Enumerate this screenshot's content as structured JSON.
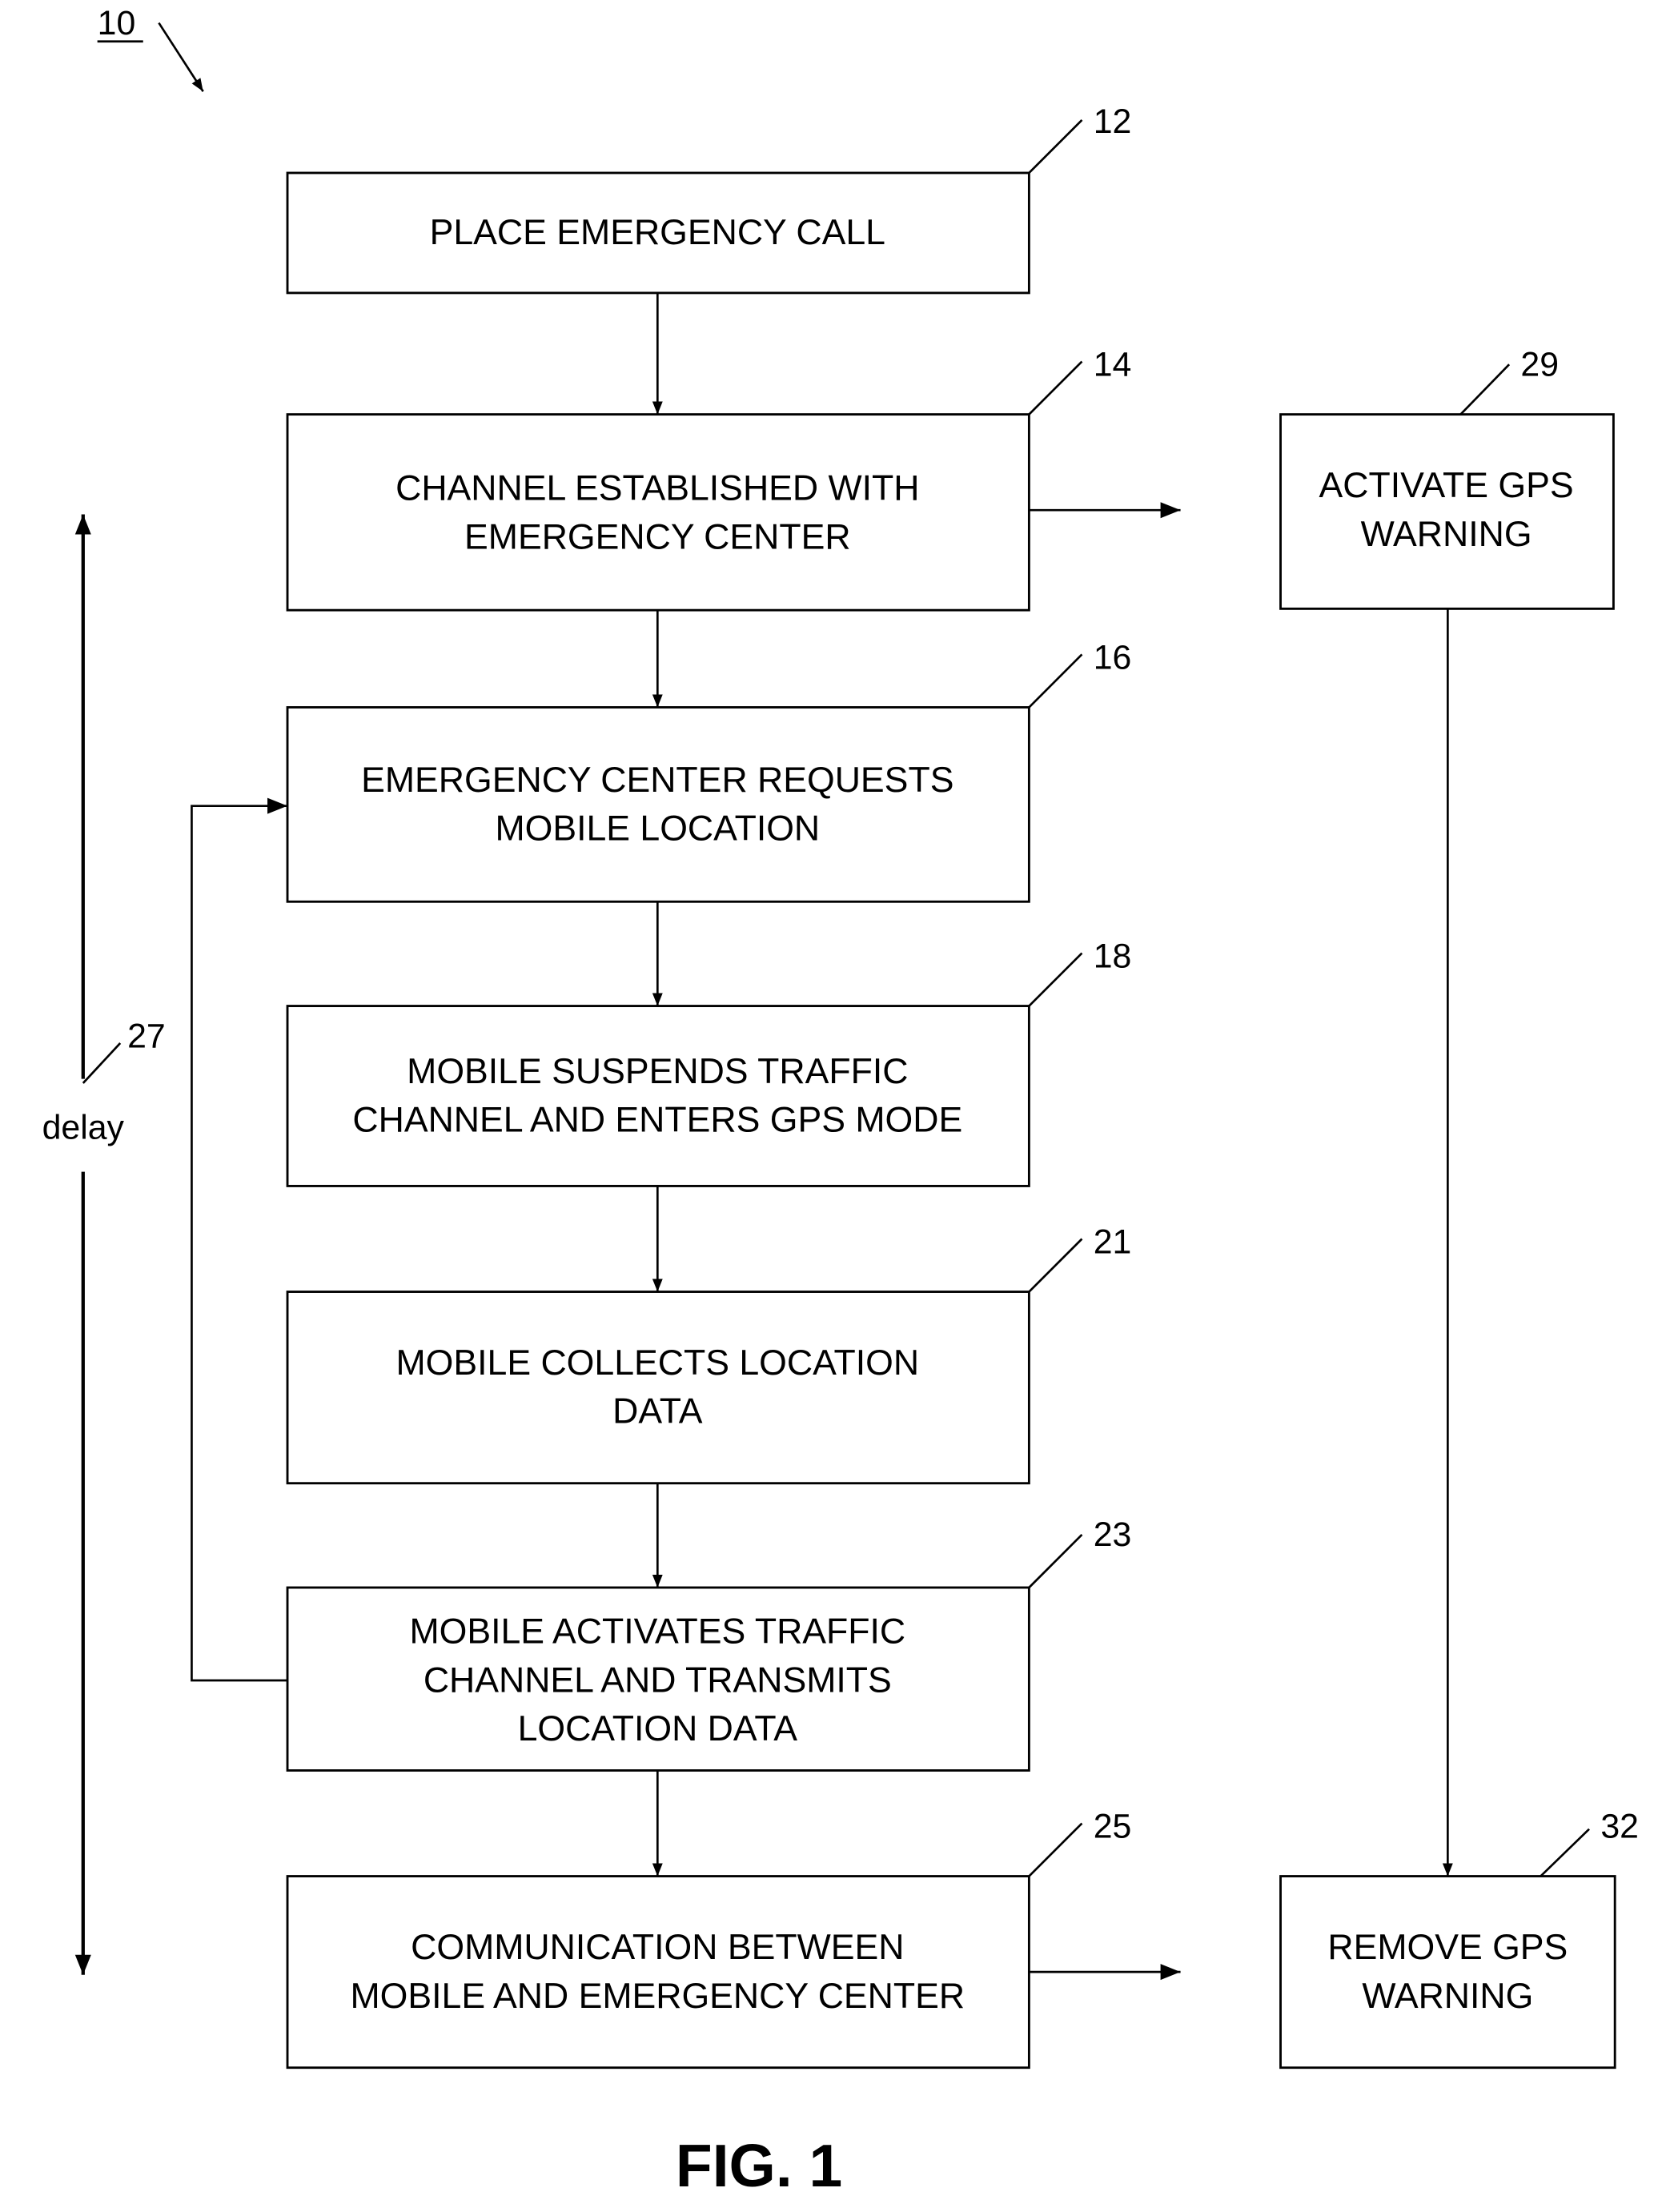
{
  "figure_ref": "10",
  "figure_caption": "FIG. 1",
  "delay_label": "delay",
  "delay_ref": "27",
  "steps": [
    {
      "ref": "12",
      "lines": [
        "PLACE EMERGENCY CALL"
      ]
    },
    {
      "ref": "14",
      "lines": [
        "CHANNEL ESTABLISHED WITH",
        "EMERGENCY CENTER"
      ]
    },
    {
      "ref": "16",
      "lines": [
        "EMERGENCY CENTER REQUESTS",
        "MOBILE LOCATION"
      ]
    },
    {
      "ref": "18",
      "lines": [
        "MOBILE SUSPENDS TRAFFIC",
        "CHANNEL AND ENTERS GPS MODE"
      ]
    },
    {
      "ref": "21",
      "lines": [
        "MOBILE COLLECTS  LOCATION",
        "DATA"
      ]
    },
    {
      "ref": "23",
      "lines": [
        "MOBILE ACTIVATES  TRAFFIC",
        "CHANNEL AND TRANSMITS",
        "LOCATION DATA"
      ]
    },
    {
      "ref": "25",
      "lines": [
        "COMMUNICATION BETWEEN",
        "MOBILE AND EMERGENCY CENTER"
      ]
    }
  ],
  "side_steps": [
    {
      "ref": "29",
      "lines": [
        "ACTIVATE GPS",
        "WARNING"
      ]
    },
    {
      "ref": "32",
      "lines": [
        "REMOVE GPS",
        "WARNING"
      ]
    }
  ]
}
